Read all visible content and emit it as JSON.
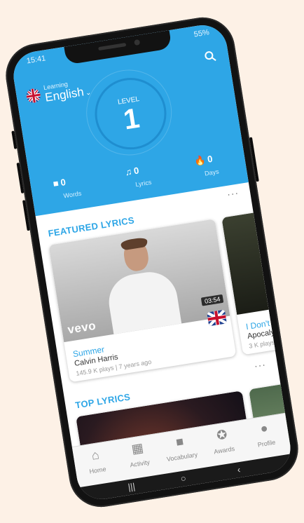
{
  "status": {
    "time": "15:41",
    "battery": "55%"
  },
  "header": {
    "learning_label": "Learning",
    "language": "English",
    "level_label": "LEVEL",
    "level_value": "1",
    "stats": [
      {
        "value": "0",
        "label": "Words",
        "icon": "book-icon"
      },
      {
        "value": "0",
        "label": "Lyrics",
        "icon": "music-note-icon"
      },
      {
        "value": "0",
        "label": "Days",
        "icon": "flame-icon"
      }
    ]
  },
  "featured": {
    "title": "FEATURED LYRICS",
    "more": "···",
    "cards": [
      {
        "title": "Summer",
        "artist": "Calvin Harris",
        "meta": "145.9 K plays | 7 years ago",
        "duration": "03:54",
        "brand": "vevo"
      },
      {
        "title": "I Don't",
        "artist": "Apocaly",
        "meta": "3 K plays"
      }
    ]
  },
  "top": {
    "title": "TOP LYRICS",
    "more": "···"
  },
  "tabs": [
    {
      "label": "Home",
      "icon": "home-icon"
    },
    {
      "label": "Activity",
      "icon": "calendar-icon"
    },
    {
      "label": "Vocabulary",
      "icon": "book-icon"
    },
    {
      "label": "Awards",
      "icon": "award-icon"
    },
    {
      "label": "Profile",
      "icon": "person-icon"
    }
  ],
  "colors": {
    "accent": "#2ea6e6",
    "ring": "#1f8ed0",
    "background": "#fdf1e6"
  }
}
